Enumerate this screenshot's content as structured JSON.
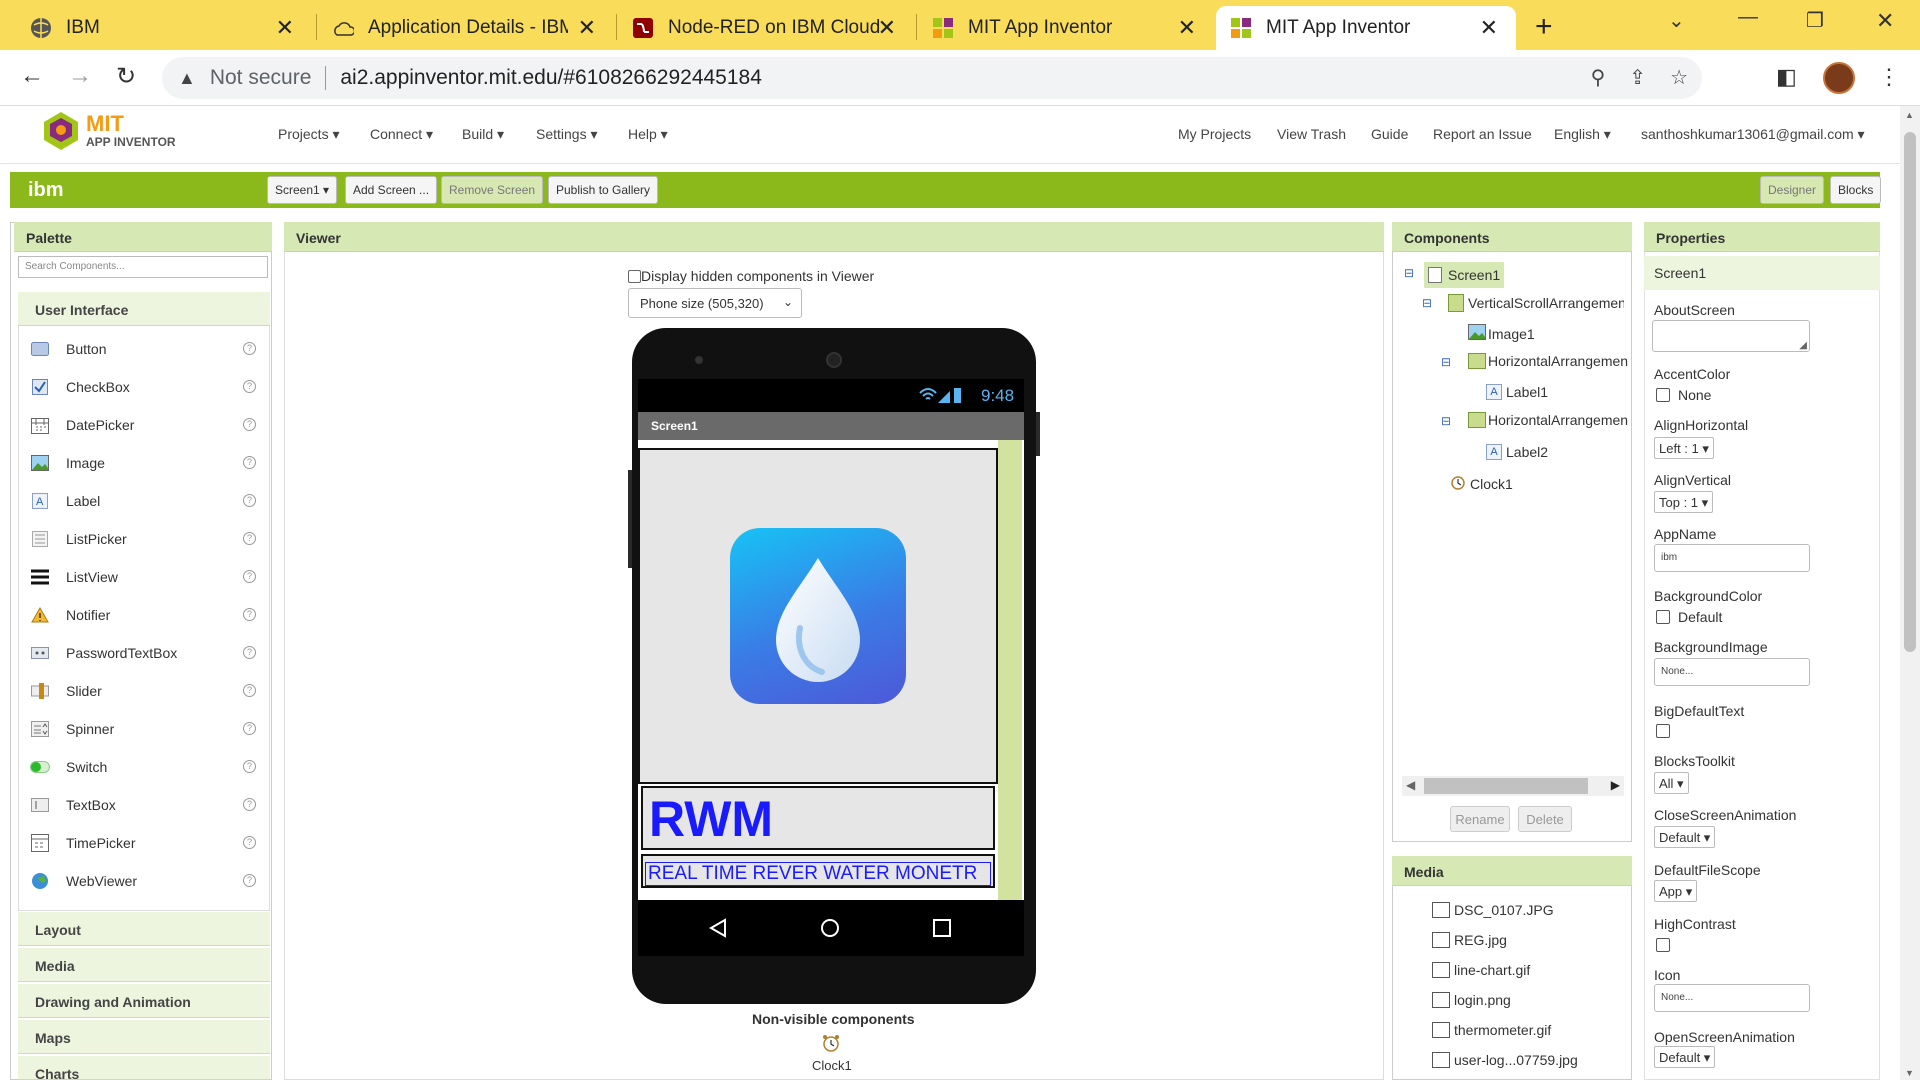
{
  "browser": {
    "tabs": [
      {
        "title": "IBM"
      },
      {
        "title": "Application Details - IBM C"
      },
      {
        "title": "Node-RED on IBM Cloud"
      },
      {
        "title": "MIT App Inventor"
      },
      {
        "title": "MIT App Inventor"
      }
    ],
    "security_label": "Not secure",
    "url": "ai2.appinventor.mit.edu/#6108266292445184"
  },
  "app": {
    "logo_title": "MIT",
    "logo_subtitle": "APP INVENTOR",
    "menu_left": [
      "Projects ▾",
      "Connect ▾",
      "Build ▾",
      "Settings ▾",
      "Help ▾"
    ],
    "menu_right": [
      "My Projects",
      "View Trash",
      "Guide",
      "Report an Issue",
      "English ▾",
      "santhoshkumar13061@gmail.com ▾"
    ]
  },
  "toolbar": {
    "project_name": "ibm",
    "screen_select": "Screen1 ▾",
    "add_screen": "Add Screen ...",
    "remove_screen": "Remove Screen",
    "publish": "Publish to Gallery",
    "designer": "Designer",
    "blocks": "Blocks"
  },
  "palette": {
    "header": "Palette",
    "search_placeholder": "Search Components...",
    "category_open": "User Interface",
    "items": [
      "Button",
      "CheckBox",
      "DatePicker",
      "Image",
      "Label",
      "ListPicker",
      "ListView",
      "Notifier",
      "PasswordTextBox",
      "Slider",
      "Spinner",
      "Switch",
      "TextBox",
      "TimePicker",
      "WebViewer"
    ],
    "categories": [
      "Layout",
      "Media",
      "Drawing and Animation",
      "Maps",
      "Charts"
    ]
  },
  "viewer": {
    "header": "Viewer",
    "hidden_checkbox_label": "Display hidden components in Viewer",
    "size_select": "Phone size (505,320)",
    "phone_time": "9:48",
    "screen_title": "Screen1",
    "label1": "RWM",
    "label2": "REAL TIME REVER WATER MONETR",
    "nonvisible_header": "Non-visible components",
    "nonvisible_item": "Clock1"
  },
  "components": {
    "header": "Components",
    "tree": [
      "Screen1",
      "VerticalScrollArrangemen",
      "Image1",
      "HorizontalArrangemen",
      "Label1",
      "HorizontalArrangemen",
      "Label2",
      "Clock1"
    ],
    "rename": "Rename",
    "delete": "Delete"
  },
  "media": {
    "header": "Media",
    "files": [
      "DSC_0107.JPG",
      "REG.jpg",
      "line-chart.gif",
      "login.png",
      "thermometer.gif",
      "user-log...07759.jpg"
    ]
  },
  "properties": {
    "header": "Properties",
    "component": "Screen1",
    "about_label": "AboutScreen",
    "accent_label": "AccentColor",
    "accent_value": "None",
    "align_h_label": "AlignHorizontal",
    "align_h_value": "Left : 1 ▾",
    "align_v_label": "AlignVertical",
    "align_v_value": "Top : 1 ▾",
    "appname_label": "AppName",
    "appname_value": "ibm",
    "bgcolor_label": "BackgroundColor",
    "bgcolor_value": "Default",
    "bgimage_label": "BackgroundImage",
    "bgimage_value": "None...",
    "bigtext_label": "BigDefaultText",
    "blocks_label": "BlocksToolkit",
    "blocks_value": "All ▾",
    "close_anim_label": "CloseScreenAnimation",
    "close_anim_value": "Default ▾",
    "filescope_label": "DefaultFileScope",
    "filescope_value": "App ▾",
    "contrast_label": "HighContrast",
    "icon_label": "Icon",
    "icon_value": "None...",
    "open_anim_label": "OpenScreenAnimation",
    "open_anim_value": "Default ▾"
  },
  "colors": {
    "chrome_tabbar": "#f8dc5a",
    "app_green": "#8bb91c",
    "panel_header": "#d6e8b4",
    "label_blue": "#1a1aff"
  }
}
